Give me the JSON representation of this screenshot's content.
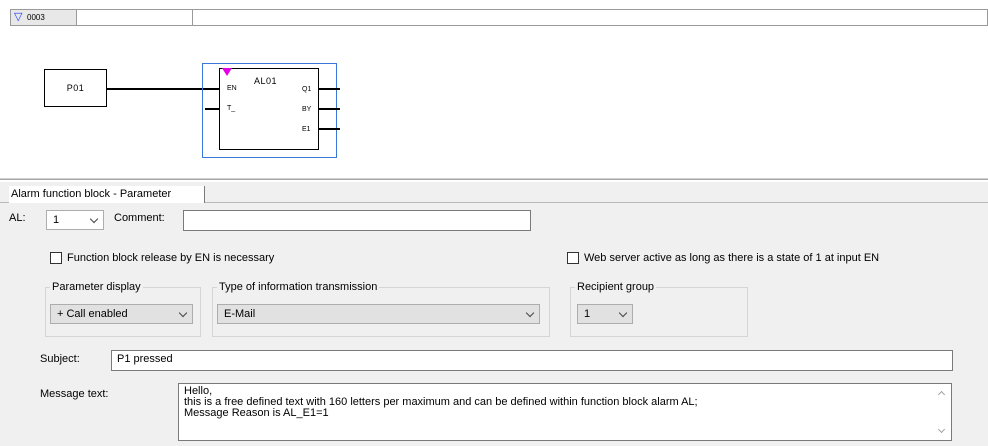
{
  "diagram": {
    "rung_number": "0003",
    "contact_label": "P01",
    "function_block": {
      "name": "AL01",
      "inputs": [
        "EN",
        "T_"
      ],
      "outputs": [
        "Q1",
        "BY",
        "E1"
      ]
    }
  },
  "panel": {
    "tab_label": "Alarm function block - Parameter",
    "al_label": "AL:",
    "al_value": "1",
    "comment_label": "Comment:",
    "comment_value": "",
    "release_checkbox_label": "Function block release by EN is necessary",
    "release_checked": false,
    "webserver_checkbox_label": "Web server active as long as there is a state of 1 at input EN",
    "webserver_checked": false,
    "param_display_title": "Parameter display",
    "param_display_value": "+ Call enabled",
    "transmission_title": "Type of information transmission",
    "transmission_value": "E-Mail",
    "recipient_title": "Recipient group",
    "recipient_value": "1",
    "subject_label": "Subject:",
    "subject_value": "P1 pressed",
    "message_label": "Message text:",
    "message_lines": [
      "Hello,",
      "this is a free defined text with 160 letters per maximum and can be defined within function block alarm AL;",
      "Message Reason is AL_E1=1"
    ]
  },
  "colors": {
    "rung_triangle": "#1a33ff",
    "selection": "#3a78d8",
    "marker": "#e400e4",
    "panel_bg": "#f0f0f0"
  },
  "icons": [
    "collapse-triangle-icon",
    "chevron-down-icon",
    "scroll-up-icon",
    "scroll-down-icon",
    "edge-marker-icon"
  ]
}
